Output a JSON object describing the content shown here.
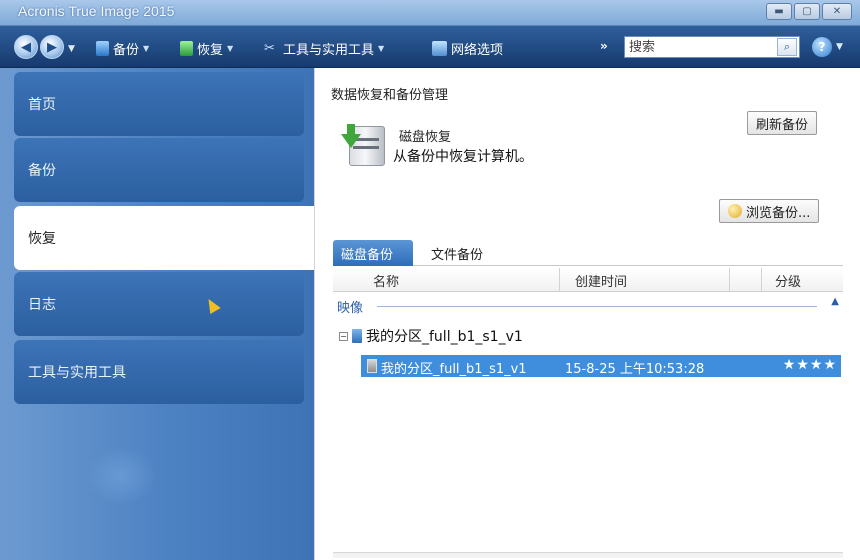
{
  "window": {
    "title": "Acronis True Image 2015",
    "controls": [
      "minimize",
      "maximize",
      "close"
    ]
  },
  "toolbar": {
    "items": [
      {
        "label": "备份",
        "icon": "backup-icon"
      },
      {
        "label": "恢复",
        "icon": "restore-icon"
      },
      {
        "label": "工具与实用工具",
        "icon": "tools-icon"
      },
      {
        "label": "网络选项",
        "icon": "network-icon"
      }
    ],
    "chevron": "»",
    "search_placeholder": "搜索",
    "help_label": "?"
  },
  "sidebar": {
    "items": [
      {
        "label": "首页"
      },
      {
        "label": "备份"
      },
      {
        "label": "恢复",
        "selected": true
      },
      {
        "label": "日志"
      },
      {
        "label": "工具与实用工具"
      }
    ]
  },
  "main": {
    "heading": "数据恢复和备份管理",
    "disk_title": "磁盘恢复",
    "disk_desc": "从备份中恢复计算机。",
    "refresh_button": "刷新备份",
    "browse_button": "浏览备份...",
    "tabs": [
      {
        "label": "磁盘备份",
        "active": true
      },
      {
        "label": "文件备份"
      }
    ],
    "columns": [
      "名称",
      "创建时间",
      "分级"
    ],
    "group_label": "映像",
    "tree_node": "我的分区_full_b1_s1_v1",
    "rows": [
      {
        "name": "我的分区_full_b1_s1_v1",
        "created": "15-8-25 上午10:53:28",
        "rating": 4,
        "stars": "★★★★"
      }
    ]
  }
}
